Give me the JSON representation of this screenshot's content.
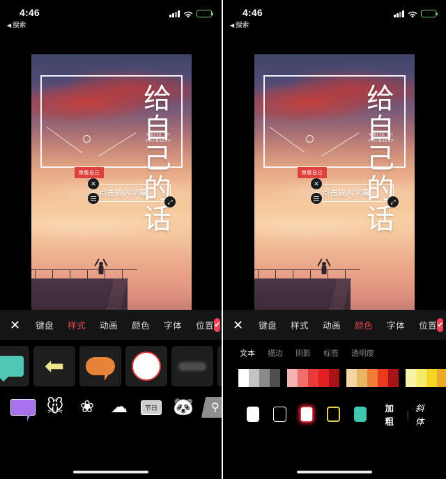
{
  "status_bar": {
    "time": "4:46",
    "back_label": "搜索",
    "back_arrow": "◀",
    "signal_icon": "cellular-signal-icon",
    "wifi_icon": "wifi-icon",
    "battery_icon": "battery-charging-icon",
    "battery_bolt": "⚡"
  },
  "poster": {
    "title_chars": [
      "给",
      "自",
      "己",
      "的",
      "话"
    ],
    "title_col_a": "给\n自\n己",
    "title_col_b": "的\n话",
    "subtitle_line1": "WRITE TO",
    "subtitle_line2": "YOURSELF",
    "badge": "致敬自己",
    "scene_description": "sunset-rooftop-silhouette"
  },
  "text_box": {
    "placeholder": "点击输入字幕",
    "close_icon": "close-icon",
    "menu_icon": "menu-lines-icon",
    "scale_icon": "resize-rotate-icon"
  },
  "toolbar": {
    "close_icon": "close-icon",
    "confirm_icon": "check-icon",
    "confirm_color": "#ef4457",
    "active_color": "#e8454f",
    "tabs": [
      {
        "label": "键盘"
      },
      {
        "label": "样式"
      },
      {
        "label": "动画"
      },
      {
        "label": "颜色"
      },
      {
        "label": "字体"
      },
      {
        "label": "位置"
      }
    ],
    "left_active_index": 1,
    "right_active_index": 3
  },
  "left_panel": {
    "name": "style-picker",
    "row1": [
      {
        "name": "style-teal-bubble",
        "icon": "speech-bubble-teal-icon"
      },
      {
        "name": "style-yellow-arrow",
        "icon": "arrow-left-yellow-icon",
        "glyph": "⬅"
      },
      {
        "name": "style-orange-bubble",
        "icon": "speech-bubble-orange-icon"
      },
      {
        "name": "style-red-circle",
        "icon": "circle-red-outline-icon"
      },
      {
        "name": "style-gray-bar",
        "icon": "blurred-bar-icon"
      },
      {
        "name": "style-green-blob",
        "icon": "blob-green-icon"
      }
    ],
    "row2": [
      {
        "name": "style-purple-bubble",
        "icon": "speech-bubble-purple-icon"
      },
      {
        "name": "style-mouse-sticker",
        "icon": "mouse-sticker-icon",
        "glyph": "🐭"
      },
      {
        "name": "style-flower-sticker",
        "icon": "flower-sticker-icon",
        "glyph": "❀"
      },
      {
        "name": "style-cloud-sticker",
        "icon": "cloud-sticker-icon",
        "glyph": "☁"
      },
      {
        "name": "style-holiday-badge",
        "icon": "holiday-badge-icon",
        "label": "节日"
      },
      {
        "name": "style-panda-sticker",
        "icon": "panda-sticker-icon",
        "glyph": "🐼"
      },
      {
        "name": "style-location-pin",
        "icon": "location-pin-icon",
        "glyph": "⚲"
      }
    ]
  },
  "right_panel": {
    "name": "color-picker",
    "subtabs": [
      {
        "label": "文本"
      },
      {
        "label": "描边"
      },
      {
        "label": "阴影"
      },
      {
        "label": "标签"
      },
      {
        "label": "透明度"
      }
    ],
    "active_subtab_index": 0,
    "palette_groups": [
      {
        "name": "grayscale",
        "colors": [
          "#ffffff",
          "#c2c2c2",
          "#8a8a8a",
          "#4f4f4f"
        ]
      },
      {
        "name": "reds",
        "colors": [
          "#f3b3b3",
          "#ef6f6a",
          "#ea3b3b",
          "#e21f22",
          "#a81418"
        ]
      },
      {
        "name": "oranges",
        "colors": [
          "#f3d4a6",
          "#eab662",
          "#ef7d36",
          "#e83b1d",
          "#a81418"
        ]
      },
      {
        "name": "yellows",
        "colors": [
          "#f7f2a8",
          "#f6ea6a",
          "#f5d327",
          "#eda92a",
          "#e8851e"
        ]
      }
    ],
    "text_styles": [
      {
        "name": "text-style-white-fill",
        "type": "fill-white"
      },
      {
        "name": "text-style-white-outline",
        "type": "out-white"
      },
      {
        "name": "text-style-red-glow",
        "type": "glow-red"
      },
      {
        "name": "text-style-yellow-outline",
        "type": "out-yellow"
      },
      {
        "name": "text-style-teal-fill",
        "type": "fill-teal"
      }
    ],
    "bold_label": "加粗",
    "separator": "|",
    "italic_label": "斜体"
  }
}
